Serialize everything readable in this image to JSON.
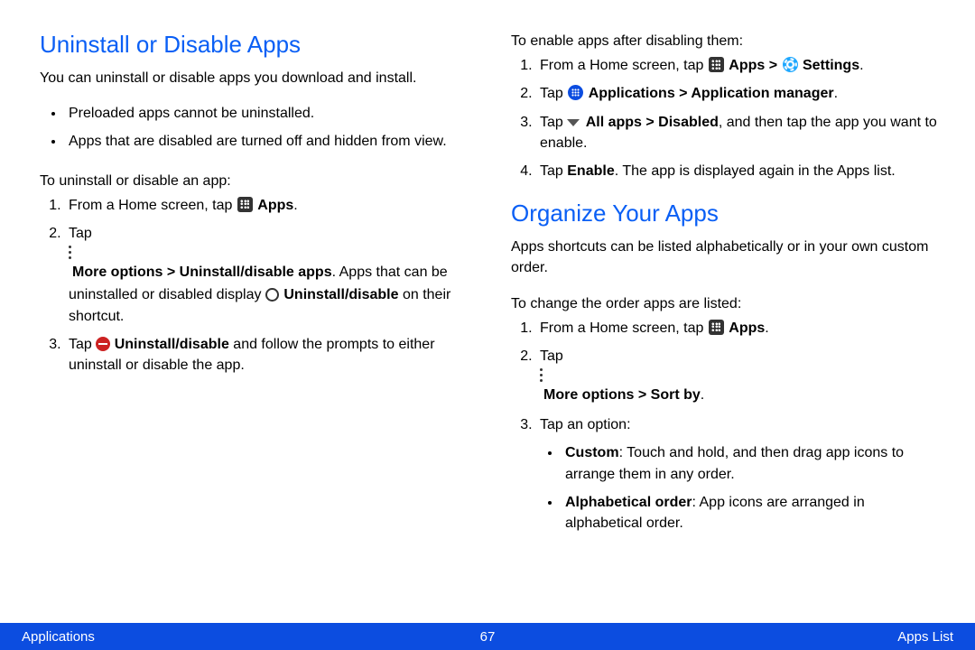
{
  "left": {
    "heading": "Uninstall or Disable Apps",
    "intro": "You can uninstall or disable apps you download and install.",
    "bullet1": "Preloaded apps cannot be uninstalled.",
    "bullet2": "Apps that are disabled are turned off and hidden from view.",
    "howIntro": "To uninstall or disable an app:",
    "step1_pre": "From a Home screen, tap ",
    "step1_apps": "Apps",
    "step2_tap": "Tap ",
    "step2_more": "More options > Uninstall/disable apps",
    "step2_after": ". Apps that can be uninstalled or disabled display ",
    "step2_ud": "Uninstall/disable",
    "step2_tail": " on their shortcut.",
    "step3_tap": "Tap ",
    "step3_ud": "Uninstall/disable",
    "step3_tail": " and follow the prompts to either uninstall or disable the app."
  },
  "rightTop": {
    "intro": "To enable apps after disabling them:",
    "s1_pre": "From a Home screen, tap ",
    "s1_apps": "Apps > ",
    "s1_settings": "Settings",
    "s2_tap": "Tap ",
    "s2_rest": "Applications > Application manager",
    "s3_tap": "Tap ",
    "s3_all": "All apps > Disabled",
    "s3_tail": ", and then tap the app you want to enable.",
    "s4_pre": "Tap ",
    "s4_en": "Enable",
    "s4_tail": ". The app is displayed again in the Apps list."
  },
  "rightOrg": {
    "heading": "Organize Your Apps",
    "intro": "Apps shortcuts can be listed alphabetically or in your own custom order.",
    "howIntro": "To change the order apps are listed:",
    "s1_pre": "From a Home screen, tap ",
    "s1_apps": "Apps",
    "s2_tap": "Tap ",
    "s2_more": "More options > Sort by",
    "s3": "Tap an option:",
    "opt1_head": "Custom",
    "opt1_tail": ": Touch and hold, and then drag app icons to arrange them in any order.",
    "opt2_head": "Alphabetical order",
    "opt2_tail": ": App icons are arranged in alphabetical order."
  },
  "footer": {
    "left": "Applications",
    "center": "67",
    "right": "Apps List"
  }
}
